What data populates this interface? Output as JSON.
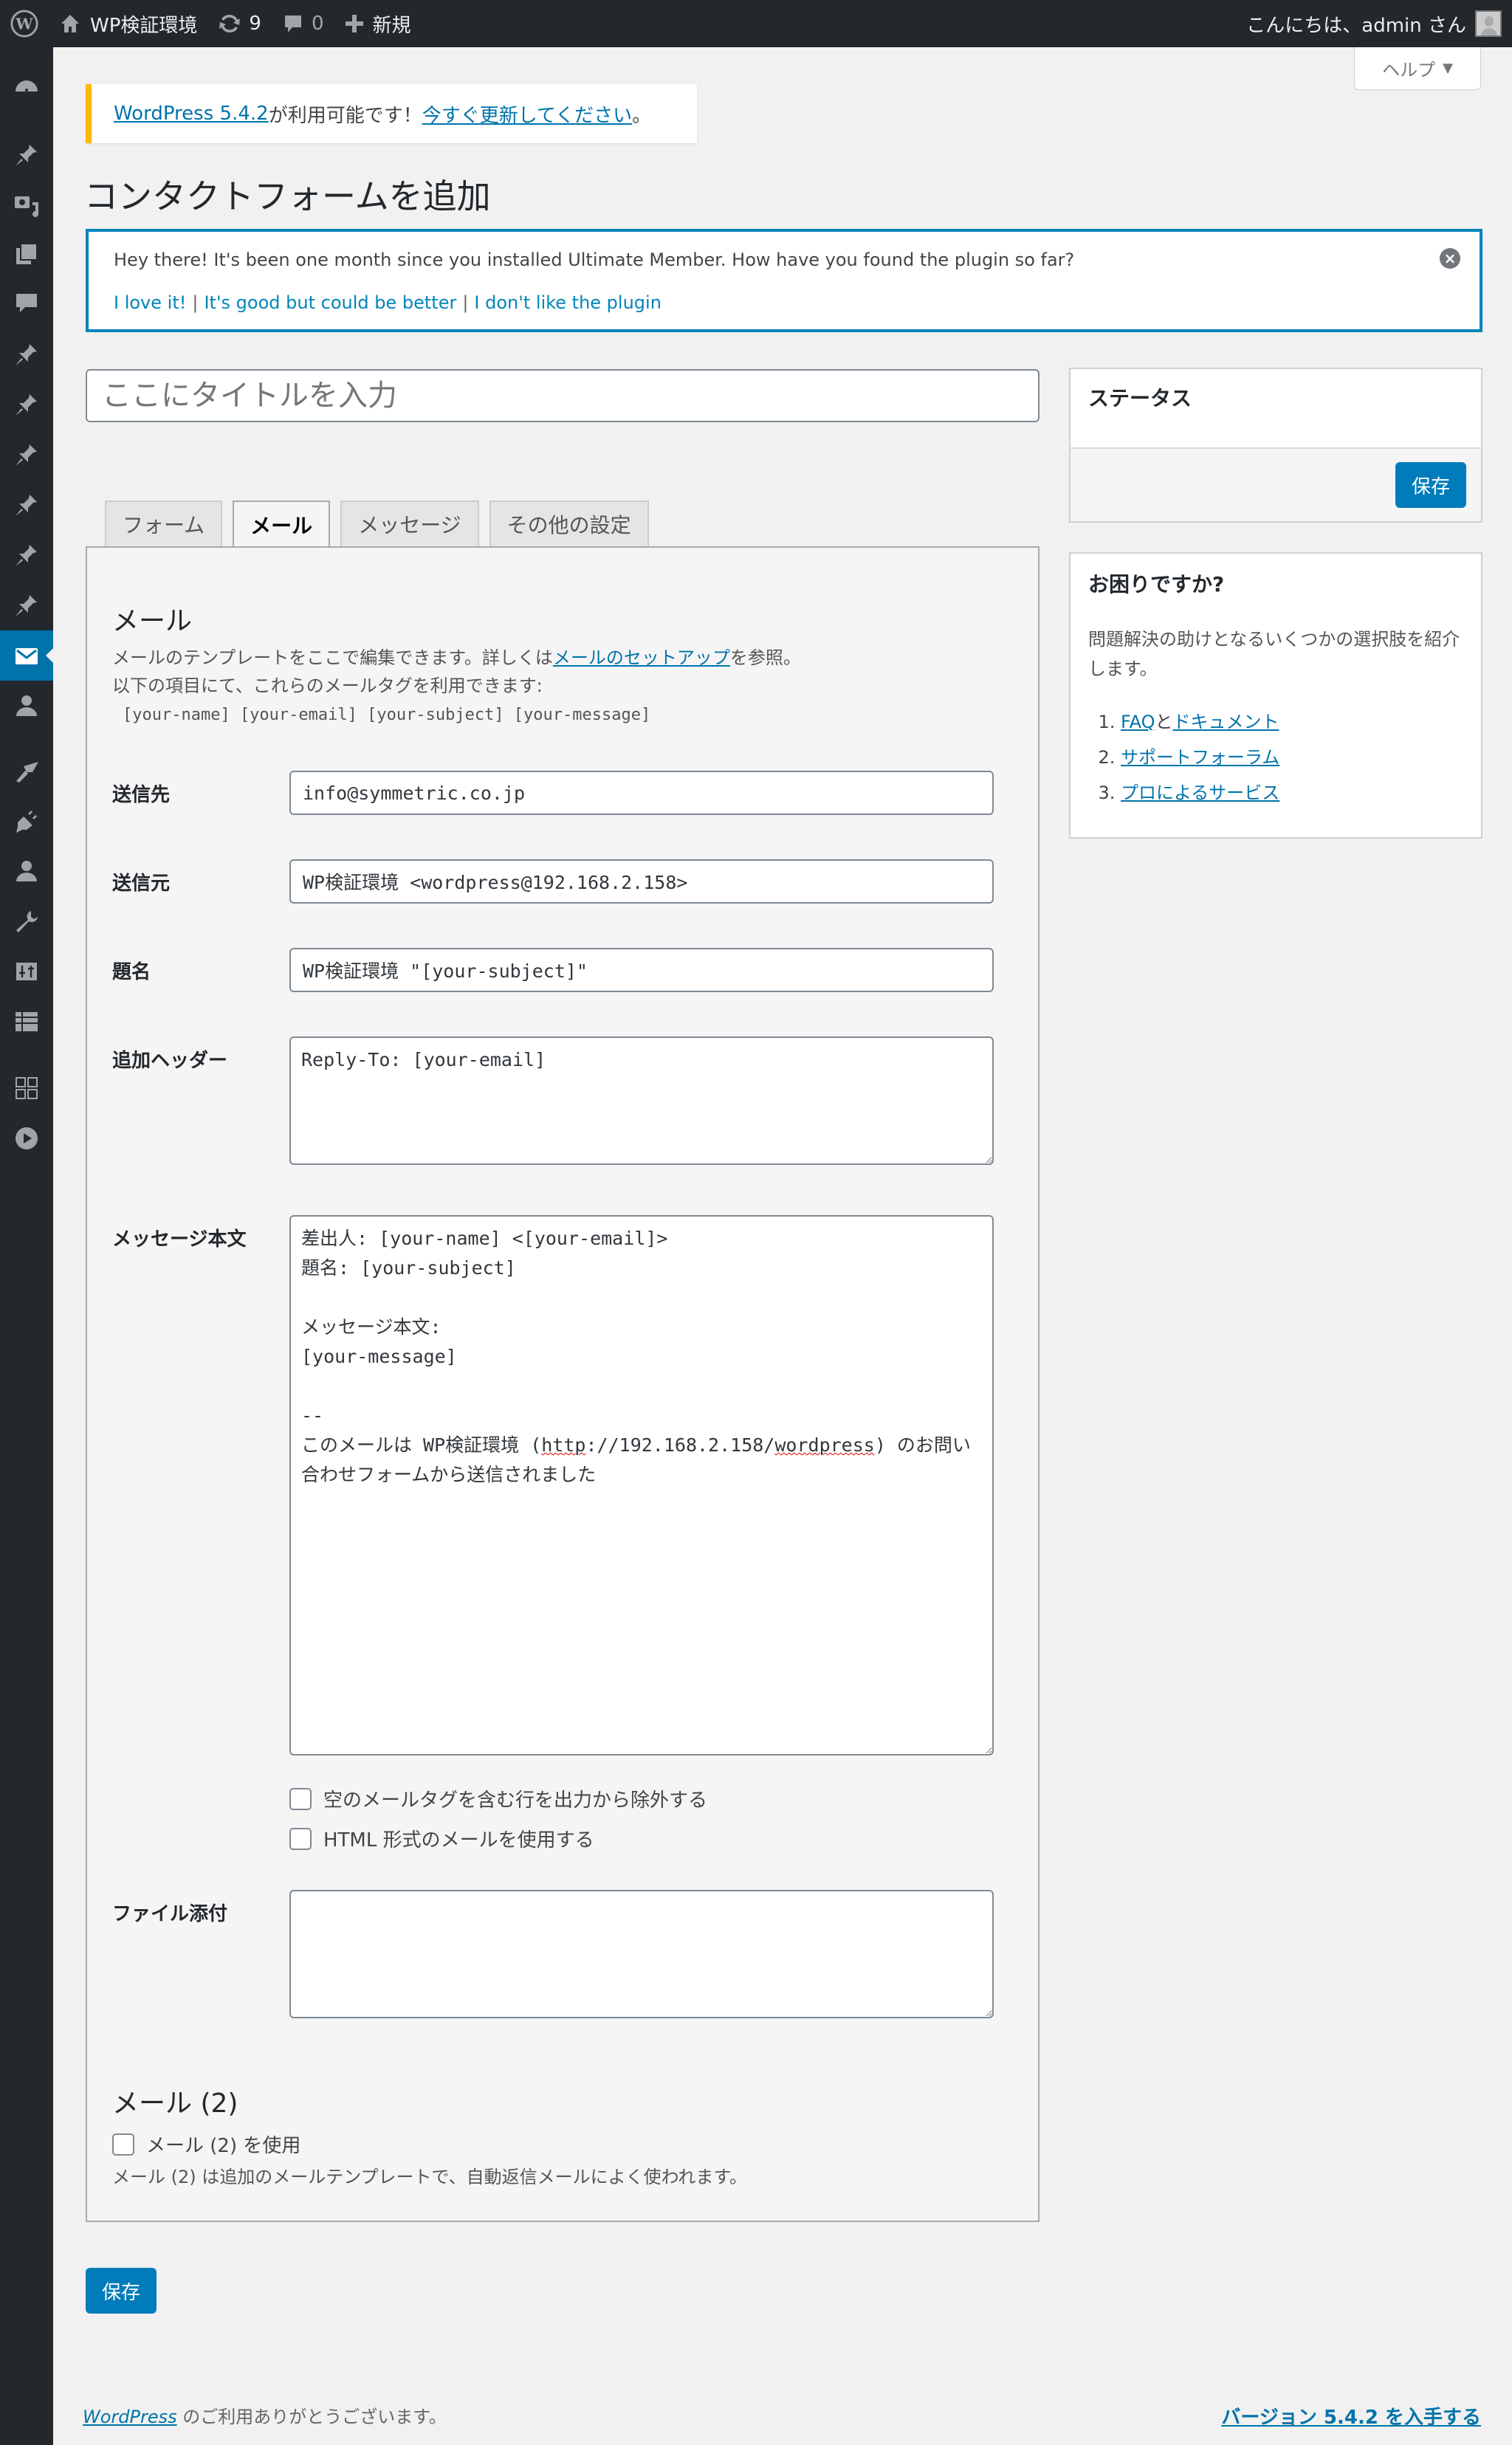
{
  "adminbar": {
    "site_name": "WP検証環境",
    "updates_count": "9",
    "comments_count": "0",
    "new_label": "新規",
    "greeting": "こんにちは、admin さん"
  },
  "sidebar": {
    "items": [
      {
        "icon": "dashboard-icon"
      },
      {
        "icon": "pin-icon"
      },
      {
        "icon": "media-icon"
      },
      {
        "icon": "pages-icon"
      },
      {
        "icon": "comments-icon"
      },
      {
        "icon": "pin-icon"
      },
      {
        "icon": "pin-icon"
      },
      {
        "icon": "pin-icon"
      },
      {
        "icon": "pin-icon"
      },
      {
        "icon": "pin-icon"
      },
      {
        "icon": "pin-icon"
      },
      {
        "icon": "mail-icon",
        "active": true
      },
      {
        "icon": "user-icon"
      },
      {
        "icon": "paintbrush-icon"
      },
      {
        "icon": "plugin-icon"
      },
      {
        "icon": "users-icon"
      },
      {
        "icon": "wrench-icon"
      },
      {
        "icon": "sliders-icon"
      },
      {
        "icon": "table-icon"
      },
      {
        "icon": "grid-icon"
      },
      {
        "icon": "play-icon"
      }
    ]
  },
  "help_tab": {
    "label": "ヘルプ",
    "arrow": "▼"
  },
  "update_nag": {
    "version_link": "WordPress 5.4.2",
    "text_mid": " が利用可能です！",
    "update_link": "今すぐ更新してください",
    "text_end": "。"
  },
  "page_title": "コンタクトフォームを追加",
  "um_notice": {
    "message": "Hey there! It's been one month since you installed Ultimate Member. How have you found the plugin so far?",
    "links": [
      "I love it!",
      "It's good but could be better",
      "I don't like the plugin"
    ],
    "separator": "|"
  },
  "title_input": {
    "placeholder": "ここにタイトルを入力",
    "value": ""
  },
  "tabs": [
    {
      "label": "フォーム",
      "active": false
    },
    {
      "label": "メール",
      "active": true
    },
    {
      "label": "メッセージ",
      "active": false
    },
    {
      "label": "その他の設定",
      "active": false
    }
  ],
  "mail": {
    "heading": "メール",
    "desc_pre": "メールのテンプレートをここで編集できます。詳しくは",
    "desc_link": "メールのセットアップ",
    "desc_post": "を参照。",
    "desc_line2": "以下の項目にて、これらのメールタグを利用できます:",
    "tags": "[your-name] [your-email] [your-subject] [your-message]",
    "fields": {
      "to": {
        "label": "送信先",
        "value": "info@symmetric.co.jp"
      },
      "from": {
        "label": "送信元",
        "value": "WP検証環境 <wordpress@192.168.2.158>"
      },
      "subject": {
        "label": "題名",
        "value": "WP検証環境 \"[your-subject]\""
      },
      "headers": {
        "label": "追加ヘッダー",
        "value": "Reply-To: [your-email]"
      },
      "body": {
        "label": "メッセージ本文",
        "lines": [
          "差出人: [your-name] <[your-email]>",
          "題名: [your-subject]",
          "",
          "メッセージ本文:",
          "[your-message]",
          "",
          "-- ",
          "このメールは WP検証環境 (",
          "http",
          "://192.168.2.158/",
          "wordpress",
          ") のお問い合わせフォームから送信されました"
        ]
      },
      "attachments": {
        "label": "ファイル添付",
        "value": ""
      }
    },
    "checkboxes": [
      {
        "label": "空のメールタグを含む行を出力から除外する",
        "checked": false
      },
      {
        "label": "HTML 形式のメールを使用する",
        "checked": false
      }
    ]
  },
  "mail2": {
    "heading": "メール (2)",
    "checkbox_label": "メール (2) を使用",
    "checked": false,
    "description": "メール (2) は追加のメールテンプレートで、自動返信メールによく使われます。"
  },
  "save_label": "保存",
  "status_box": {
    "title": "ステータス",
    "save_label": "保存"
  },
  "help_box": {
    "title": "お困りですか?",
    "description": "問題解決の助けとなるいくつかの選択肢を紹介します。",
    "items": [
      {
        "link1": "FAQ",
        "joiner": "と",
        "link2": "ドキュメント"
      },
      {
        "link1": "サポートフォーラム"
      },
      {
        "link1": "プロによるサービス"
      }
    ]
  },
  "footer": {
    "wp_link": "WordPress",
    "thanks": " のご利用ありがとうございます。",
    "version_link": "バージョン 5.4.2 を入手する"
  }
}
